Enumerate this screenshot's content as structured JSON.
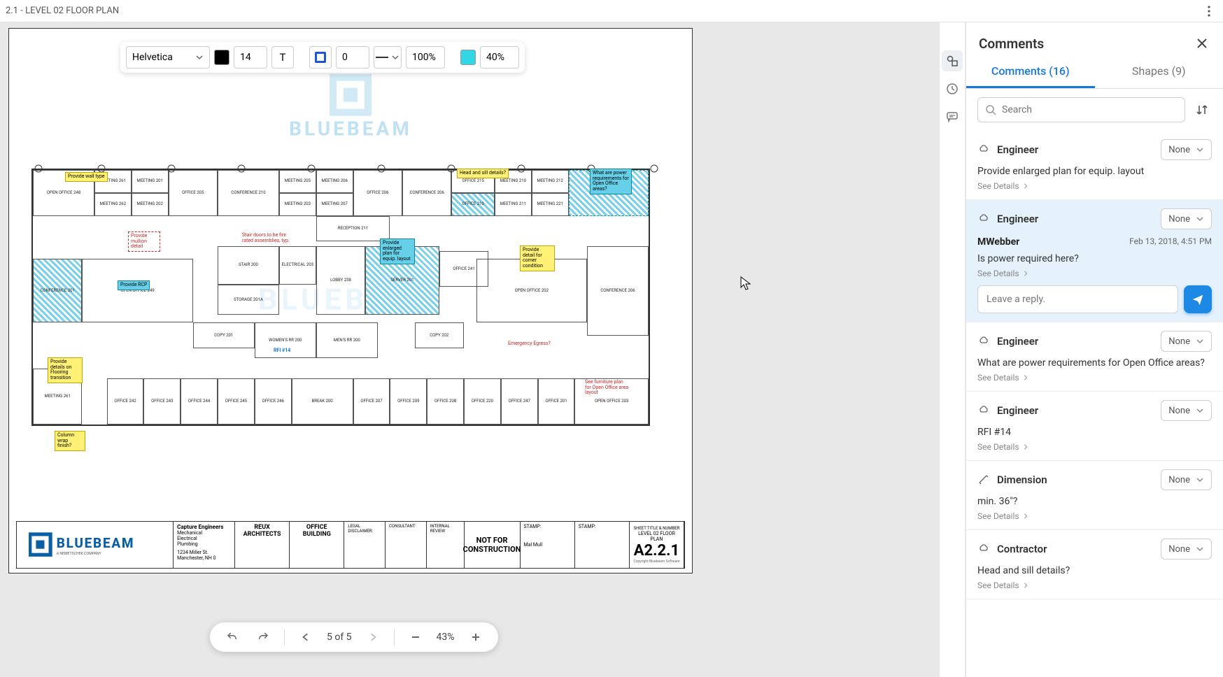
{
  "titlebar": {
    "document_title": "2.1 - LEVEL 02 FLOOR PLAN"
  },
  "format_toolbar": {
    "font_family": "Helvetica",
    "text_color": "#000000",
    "font_size": "14",
    "text_tool_label": "T",
    "stroke_color": "#1e56d6",
    "stroke_width": "0",
    "line_style": "solid",
    "opacity": "100%",
    "fill_color": "#33d6e4",
    "fill_opacity": "40%"
  },
  "canvas": {
    "watermark": "BLUEBEAM",
    "callouts": {
      "wall_type": "Provide wall type",
      "head_sill": "Head and sill details?",
      "open_office_power": "What are power requirements for Open Office areas?",
      "rcp": "Provide RCP",
      "mullion": "Provide mullion detail",
      "stair_doors": "Stair doors to be fire rated assemblies, typ.",
      "enlarged_equip": "Provide enlarged plan for equip. layout",
      "corner_detail": "Provide detail for corner condition",
      "emergency": "Emergency Egress?",
      "flooring": "Provide details on Flooring transition",
      "column_wrap": "Column wrap finish?",
      "furniture_plan": "See furniture plan for Open Office area layout",
      "rfi14": "RFI #14"
    },
    "rooms": {
      "open_office_248": "OPEN OFFICE  248",
      "open_office_249": "OPEN OFFICE  249",
      "open_office_202": "OPEN OFFICE  202",
      "open_office_203": "OPEN OFFICE  203",
      "conference_210": "CONFERENCE  210",
      "conference_206": "CONFERENCE  206",
      "conference_206b": "CONFERENCE  206",
      "conference_206c": "CONFERENCE  206",
      "conference_201": "CONFERENCE  201",
      "reception_211": "RECEPTION  211",
      "lobby_238": "LOBBY  238",
      "server_201": "SERVER  201",
      "storage_201a": "STORAGE  201A",
      "electrical_203": "ELECTRICAL  203",
      "stair_200": "STAIR  200",
      "break_200": "BREAK  200",
      "copy_201": "COPY  201",
      "copy_202": "COPY  202",
      "mens_rr_200": "MEN'S RR  200",
      "womens_rr_200": "WOMEN'S RR  200",
      "meeting_201": "MEETING  201",
      "meeting_202": "MEETING  202",
      "meeting_203": "MEETING  203",
      "meeting_205": "MEETING  205",
      "meeting_206": "MEETING  206",
      "meeting_207": "MEETING  207",
      "meeting_210": "MEETING  210",
      "meeting_211": "MEETING  211",
      "meeting_212": "MEETING  212",
      "meeting_221": "MEETING  221",
      "meeting_261": "MEETING  261",
      "meeting_262": "MEETING  262",
      "office_201": "OFFICE  201",
      "office_205": "OFFICE  205",
      "office_206": "OFFICE  206",
      "office_207": "OFFICE  207",
      "office_208": "OFFICE  208",
      "office_209": "OFFICE  209",
      "office_210": "OFFICE  210",
      "office_215": "OFFICE  215",
      "office_220": "OFFICE  220",
      "office_241": "OFFICE  241",
      "office_242": "OFFICE  242",
      "office_243": "OFFICE  243",
      "office_244": "OFFICE  244",
      "office_245": "OFFICE  245",
      "office_246": "OFFICE  246",
      "office_247": "OFFICE  247"
    },
    "titleblock": {
      "engineers_firm": "Capture Engineers",
      "disciplines": "Mechanical\nElectrical\nPlumbing",
      "address": "1234 Miller St.\nManchester, NH 0",
      "architects": "REUX ARCHITECTS",
      "project": "OFFICE BUILDING",
      "legal_disclaimer_label": "LEGAL DISCLAIMER:",
      "consultant_label": "CONSULTANT:",
      "internal_review_label": "INTERNAL REVIEW",
      "not_for": "NOT FOR CONSTRUCTION",
      "stamp_label": "STAMP:",
      "stamp_name": "Mal Mull",
      "sheet_title_label": "SHEET TITLE & NUMBER",
      "sheet_title": "LEVEL 02 FLOOR PLAN",
      "sheet_number": "A2.2.1",
      "copyright": "Copyright Bluebeam Software"
    },
    "brand_tagline": "A NEMETSCHEK COMPANY"
  },
  "docbar": {
    "page_label": "5 of 5",
    "zoom": "43%"
  },
  "comments_panel": {
    "title": "Comments",
    "tab_comments": "Comments (16)",
    "tab_shapes": "Shapes (9)",
    "search_placeholder": "Search",
    "reply_placeholder": "Leave a reply.",
    "see_details": "See Details",
    "status_none": "None",
    "items": [
      {
        "author": "Engineer",
        "icon": "cloud",
        "text": "Provide enlarged plan for equip. layout"
      },
      {
        "author": "Engineer",
        "icon": "cloud",
        "reply_author": "MWebber",
        "reply_date": "Feb 13, 2018, 4:51 PM",
        "text": "Is power required here?",
        "selected": true
      },
      {
        "author": "Engineer",
        "icon": "cloud",
        "text": "What are power requirements for Open Office areas?"
      },
      {
        "author": "Engineer",
        "icon": "cloud",
        "text": "RFI #14"
      },
      {
        "author": "Dimension",
        "icon": "dimension",
        "text": "min. 36\"?"
      },
      {
        "author": "Contractor",
        "icon": "cloud",
        "text": "Head and sill details?"
      }
    ]
  }
}
